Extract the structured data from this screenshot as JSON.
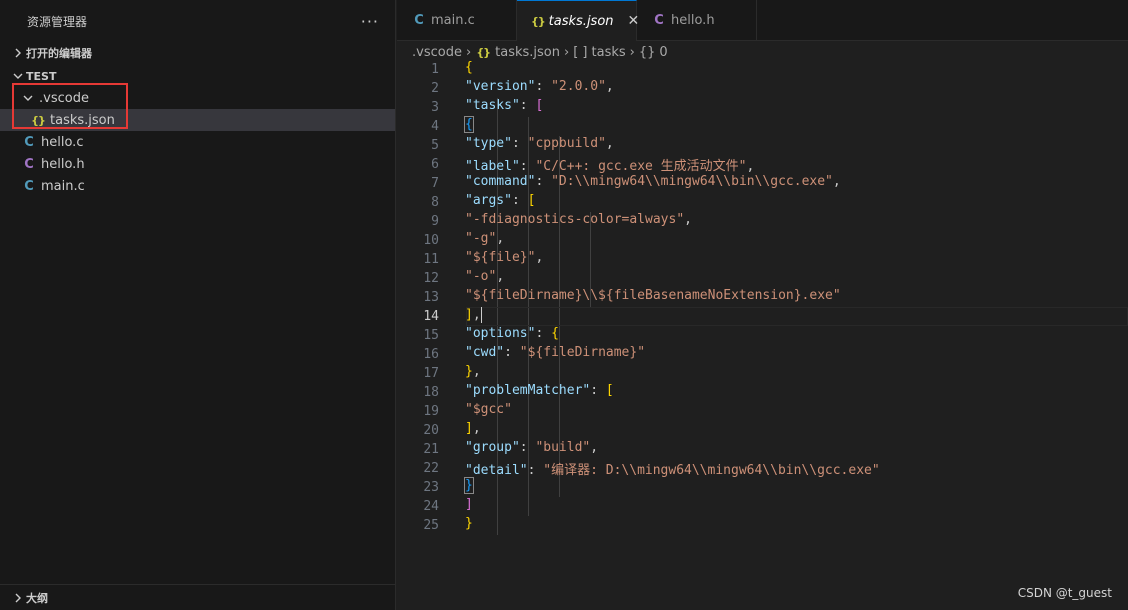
{
  "sidebar": {
    "title": "资源管理器",
    "more": "···",
    "open_editors": "打开的编辑器",
    "workspace": "TEST",
    "tree": [
      {
        "label": ".vscode",
        "type": "folder",
        "icon": "chevron-down-icon"
      },
      {
        "label": "tasks.json",
        "type": "json",
        "icon_text": "{}"
      },
      {
        "label": "hello.c",
        "type": "c",
        "icon_text": "C"
      },
      {
        "label": "hello.h",
        "type": "h",
        "icon_text": "C"
      },
      {
        "label": "main.c",
        "type": "c",
        "icon_text": "C"
      }
    ],
    "outline": "大纲"
  },
  "tabs": [
    {
      "label": "main.c",
      "icon_text": "C"
    },
    {
      "label": "tasks.json",
      "icon_text": "{}",
      "close": "✕"
    },
    {
      "label": "hello.h",
      "icon_text": "C"
    }
  ],
  "breadcrumb": {
    "folder": ".vscode",
    "file": "tasks.json",
    "json_icon": "{}",
    "array_icon": "[ ]",
    "array": "tasks",
    "obj_icon": "{}",
    "obj": "0"
  },
  "code": {
    "active_line": 14,
    "lines": [
      "1",
      "2",
      "3",
      "4",
      "5",
      "6",
      "7",
      "8",
      "9",
      "10",
      "11",
      "12",
      "13",
      "14",
      "15",
      "16",
      "17",
      "18",
      "19",
      "20",
      "21",
      "22",
      "23",
      "24",
      "25"
    ],
    "version_key": "\"version\"",
    "version_val": "\"2.0.0\"",
    "tasks_key": "\"tasks\"",
    "type_key": "\"type\"",
    "type_val": "\"cppbuild\"",
    "label_key": "\"label\"",
    "label_val": "\"C/C++: gcc.exe 生成活动文件\"",
    "command_key": "\"command\"",
    "command_val": "\"D:\\\\mingw64\\\\mingw64\\\\bin\\\\gcc.exe\"",
    "args_key": "\"args\"",
    "arg1": "\"-fdiagnostics-color=always\"",
    "arg2": "\"-g\"",
    "arg3": "\"${file}\"",
    "arg4": "\"-o\"",
    "arg5": "\"${fileDirname}\\\\${fileBasenameNoExtension}.exe\"",
    "options_key": "\"options\"",
    "cwd_key": "\"cwd\"",
    "cwd_val": "\"${fileDirname}\"",
    "pm_key": "\"problemMatcher\"",
    "pm_val": "\"$gcc\"",
    "group_key": "\"group\"",
    "group_val": "\"build\"",
    "detail_key": "\"detail\"",
    "detail_val": "\"编译器: D:\\\\mingw64\\\\mingw64\\\\bin\\\\gcc.exe\""
  },
  "watermark": "CSDN @t_guest"
}
